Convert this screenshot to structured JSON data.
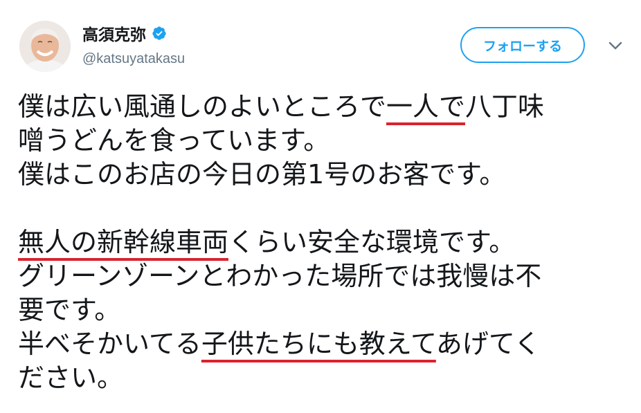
{
  "user": {
    "display_name": "高須克弥",
    "handle": "@katsuyatakasu",
    "verified": true
  },
  "follow_button": {
    "label": "フォローする"
  },
  "colors": {
    "accent": "#1da1f2",
    "underline": "#d9232e",
    "text": "#14171a",
    "secondary": "#657786"
  },
  "icons": {
    "verified": "verified-badge-icon",
    "menu": "chevron-down-icon"
  },
  "tweet": {
    "p1": {
      "l1_a": "僕は広い風通しのよいところで",
      "l1_b": "一人で",
      "l1_c": "八丁味",
      "l2": "噌うどんを食っています。",
      "l3": "僕はこのお店の今日の第1号のお客です。"
    },
    "p2": {
      "l1_a": "無人の新幹線車両",
      "l1_b": "くらい安全な環境です。",
      "l2": "グリーンゾーンとわかった場所では我慢は不",
      "l3": "要です。",
      "l4_a": "半べそかいてる",
      "l4_b": "子供たちにも教えて",
      "l4_c": "あげてく",
      "l5": "ださい。"
    }
  }
}
